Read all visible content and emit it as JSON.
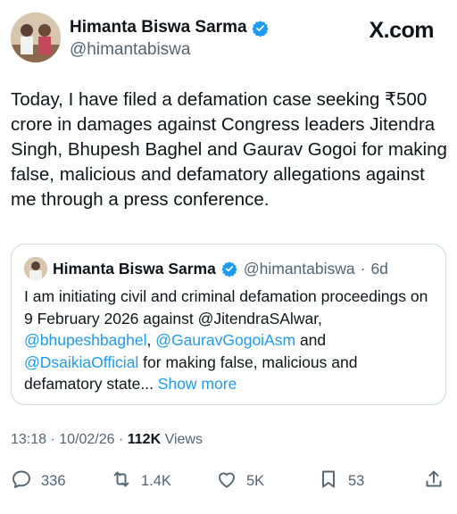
{
  "author": {
    "name": "Himanta Biswa Sarma",
    "handle": "@himantabiswa"
  },
  "site_logo": "X.com",
  "tweet": {
    "text": "Today, I have filed a defamation case seeking ₹500 crore in damages against Congress leaders Jitendra Singh, Bhupesh Baghel and Gaurav Gogoi for making false, malicious and defamatory allegations against me through a press conference."
  },
  "quote": {
    "name": "Himanta Biswa Sarma",
    "handle": "@himantabiswa",
    "separator": "·",
    "age": "6d",
    "text_part1": "I am initiating civil and criminal defamation proceedings on 9 February 2026 against @JitendraSAlwar, ",
    "mention1": "@bhupeshbaghel",
    "text_part2": ",",
    "mention2": "@GauravGogoiAsm",
    "text_part3": " and ",
    "mention3": "@DsaikiaOfficial",
    "text_part4": " for making false, malicious and defamatory state... ",
    "show_more": "Show more"
  },
  "meta": {
    "time": "13:18",
    "separator1": " · ",
    "date": "10/02/26",
    "separator2": " · ",
    "views_count": "112K",
    "views_label": " Views"
  },
  "actions": {
    "replies": "336",
    "reposts": "1.4K",
    "likes": "5K",
    "bookmarks": "53"
  },
  "colors": {
    "link": "#1d9bf0",
    "secondary_text": "#536471",
    "verified": "#1d9bf0"
  },
  "icons": [
    "verified-badge-icon",
    "reply-icon",
    "repost-icon",
    "like-icon",
    "bookmark-icon",
    "share-icon"
  ]
}
